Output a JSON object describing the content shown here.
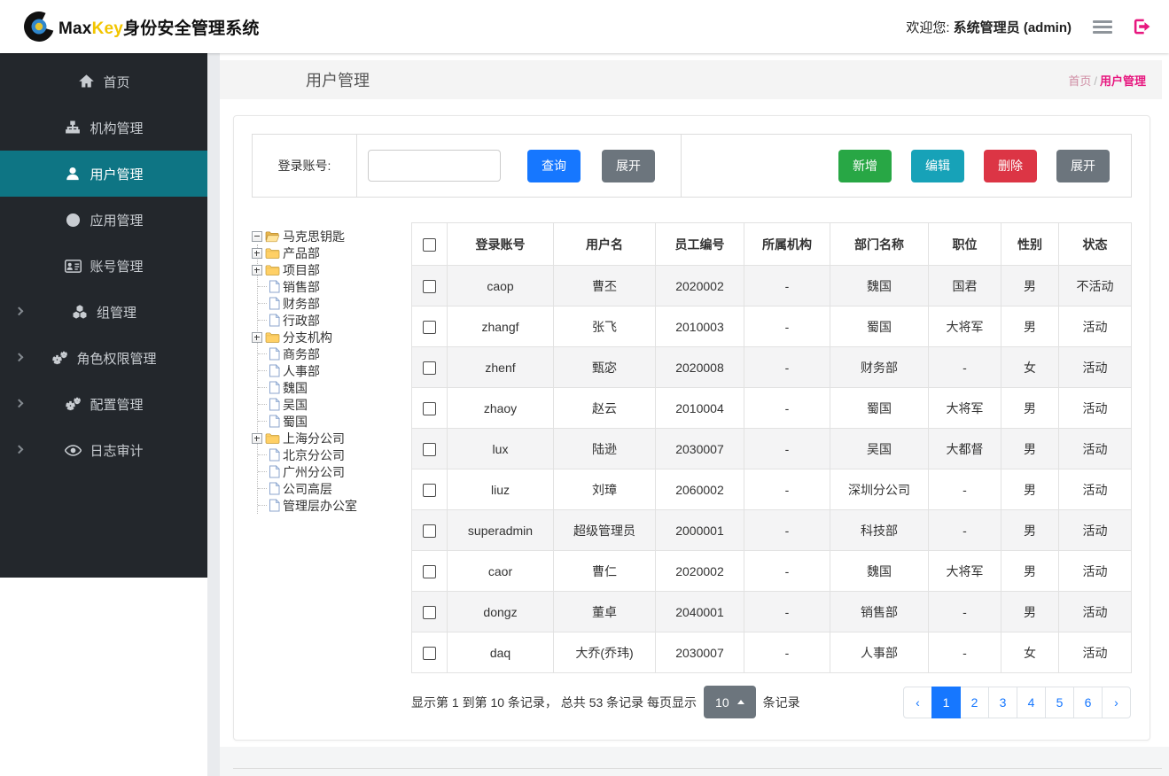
{
  "topbar": {
    "brand": {
      "max": "Max",
      "key": "Key",
      "suffix": "身份安全管理系统"
    },
    "welcome_prefix": "欢迎您:",
    "welcome_user": "系统管理员 (admin)"
  },
  "sidebar": {
    "items": [
      {
        "id": "home",
        "label": "首页",
        "icon": "home-icon",
        "active": false,
        "expandable": false
      },
      {
        "id": "org",
        "label": "机构管理",
        "icon": "sitemap-icon",
        "active": false,
        "expandable": false
      },
      {
        "id": "users",
        "label": "用户管理",
        "icon": "user-icon",
        "active": true,
        "expandable": false
      },
      {
        "id": "apps",
        "label": "应用管理",
        "icon": "globe-icon",
        "active": false,
        "expandable": false
      },
      {
        "id": "accounts",
        "label": "账号管理",
        "icon": "idcard-icon",
        "active": false,
        "expandable": false
      },
      {
        "id": "groups",
        "label": "组管理",
        "icon": "cubes-icon",
        "active": false,
        "expandable": true
      },
      {
        "id": "roles",
        "label": "角色权限管理",
        "icon": "gears-icon",
        "active": false,
        "expandable": true
      },
      {
        "id": "config",
        "label": "配置管理",
        "icon": "gears-icon",
        "active": false,
        "expandable": true
      },
      {
        "id": "audit",
        "label": "日志审计",
        "icon": "eye-icon",
        "active": false,
        "expandable": true
      }
    ]
  },
  "page": {
    "title": "用户管理",
    "breadcrumb": {
      "home": "首页",
      "separator": "/",
      "current": "用户管理"
    }
  },
  "search": {
    "label": "登录账号:",
    "input_value": "",
    "query_label": "查询",
    "expand_label": "展开"
  },
  "toolbar": {
    "add_label": "新增",
    "edit_label": "编辑",
    "delete_label": "删除",
    "expand_label": "展开"
  },
  "tree": {
    "root": {
      "label": "马克思钥匙"
    },
    "nodes": [
      {
        "label": "产品部",
        "kind": "folder"
      },
      {
        "label": "项目部",
        "kind": "folder"
      },
      {
        "label": "销售部",
        "kind": "file"
      },
      {
        "label": "财务部",
        "kind": "file"
      },
      {
        "label": "行政部",
        "kind": "file"
      },
      {
        "label": "分支机构",
        "kind": "folder"
      },
      {
        "label": "商务部",
        "kind": "file"
      },
      {
        "label": "人事部",
        "kind": "file"
      },
      {
        "label": "魏国",
        "kind": "file"
      },
      {
        "label": "吴国",
        "kind": "file"
      },
      {
        "label": "蜀国",
        "kind": "file"
      },
      {
        "label": "上海分公司",
        "kind": "folder"
      },
      {
        "label": "北京分公司",
        "kind": "file"
      },
      {
        "label": "广州分公司",
        "kind": "file"
      },
      {
        "label": "公司高层",
        "kind": "file"
      },
      {
        "label": "管理层办公室",
        "kind": "file"
      }
    ]
  },
  "table": {
    "headers": [
      "登录账号",
      "用户名",
      "员工编号",
      "所属机构",
      "部门名称",
      "职位",
      "性别",
      "状态"
    ],
    "rows": [
      [
        "caop",
        "曹丕",
        "2020002",
        "-",
        "魏国",
        "国君",
        "男",
        "不活动"
      ],
      [
        "zhangf",
        "张飞",
        "2010003",
        "-",
        "蜀国",
        "大将军",
        "男",
        "活动"
      ],
      [
        "zhenf",
        "甄宓",
        "2020008",
        "-",
        "财务部",
        "-",
        "女",
        "活动"
      ],
      [
        "zhaoy",
        "赵云",
        "2010004",
        "-",
        "蜀国",
        "大将军",
        "男",
        "活动"
      ],
      [
        "lux",
        "陆逊",
        "2030007",
        "-",
        "吴国",
        "大都督",
        "男",
        "活动"
      ],
      [
        "liuz",
        "刘璋",
        "2060002",
        "-",
        "深圳分公司",
        "-",
        "男",
        "活动"
      ],
      [
        "superadmin",
        "超级管理员",
        "2000001",
        "-",
        "科技部",
        "-",
        "男",
        "活动"
      ],
      [
        "caor",
        "曹仁",
        "2020002",
        "-",
        "魏国",
        "大将军",
        "男",
        "活动"
      ],
      [
        "dongz",
        "董卓",
        "2040001",
        "-",
        "销售部",
        "-",
        "男",
        "活动"
      ],
      [
        "daq",
        "大乔(乔玮)",
        "2030007",
        "-",
        "人事部",
        "-",
        "女",
        "活动"
      ]
    ]
  },
  "pagination": {
    "info_prefix": "显示第 1 到第 10 条记录， 总共 53 条记录  每页显示",
    "page_size": "10",
    "info_suffix": "条记录",
    "prev": "‹",
    "next": "›",
    "pages": [
      "1",
      "2",
      "3",
      "4",
      "5",
      "6"
    ],
    "active_page": "1"
  },
  "colors": {
    "sidebar_bg": "#23272c",
    "active_teal": "#0e7584",
    "primary_blue": "#1677ff",
    "green": "#28a745",
    "teal_button": "#17a2b8",
    "red": "#dc3545",
    "gray_button": "#6c757d",
    "brand_yellow": "#f2c500",
    "magenta": "#e7177f",
    "striped_row": "#f4f4f5"
  }
}
